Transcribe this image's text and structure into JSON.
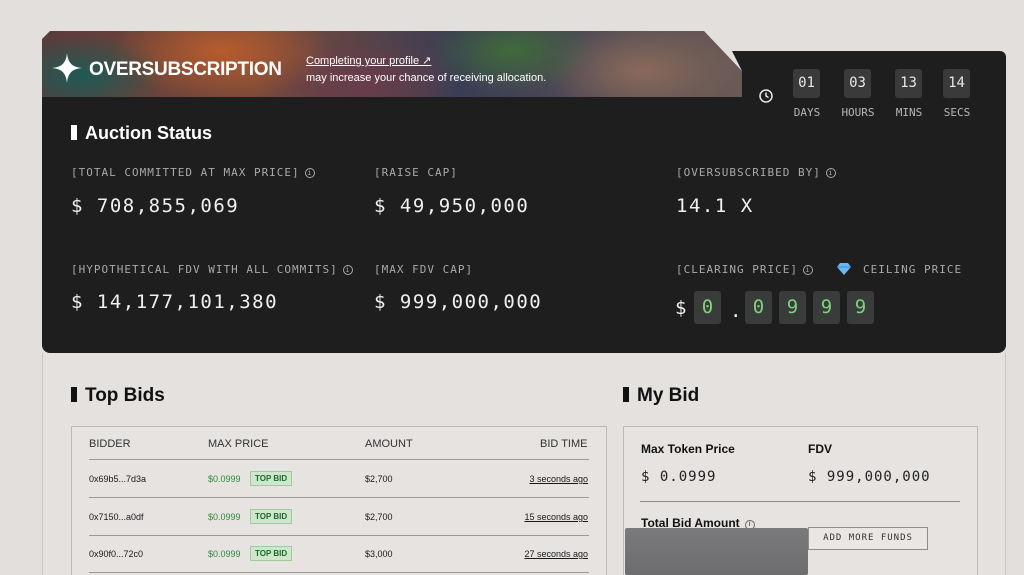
{
  "banner": {
    "title": "OVERSUBSCRIPTION",
    "note_link": "Completing your profile ↗",
    "note_text": "may increase your chance of receiving allocation."
  },
  "countdown": [
    {
      "value": "01",
      "label": "DAYS"
    },
    {
      "value": "03",
      "label": "HOURS"
    },
    {
      "value": "13",
      "label": "MINS"
    },
    {
      "value": "14",
      "label": "SECS"
    }
  ],
  "auction": {
    "heading": "Auction Status",
    "total_committed_label": "[TOTAL COMMITTED AT MAX PRICE]",
    "total_committed_value": "$ 708,855,069",
    "raise_cap_label": "[RAISE CAP]",
    "raise_cap_value": "$ 49,950,000",
    "oversubscribed_label": "[OVERSUBSCRIBED BY]",
    "oversubscribed_value": "14.1 X",
    "hypo_fdv_label": "[HYPOTHETICAL FDV WITH ALL COMMITS]",
    "hypo_fdv_value": "$ 14,177,101,380",
    "max_fdv_label": "[MAX FDV CAP]",
    "max_fdv_value": "$ 999,000,000",
    "clearing_label": "[CLEARING PRICE]",
    "ceiling_label": "CEILING PRICE",
    "clearing_currency": "$",
    "clearing_digits": [
      "0",
      "0",
      "9",
      "9",
      "9"
    ]
  },
  "top_bids": {
    "heading": "Top Bids",
    "columns": [
      "BIDDER",
      "MAX PRICE",
      "AMOUNT",
      "BID TIME"
    ],
    "rows": [
      {
        "bidder": "0x69b5...7d3a",
        "price": "$0.0999",
        "badge": "TOP BID",
        "amount": "$2,700",
        "time": "3 seconds ago"
      },
      {
        "bidder": "0x7150...a0df",
        "price": "$0.0999",
        "badge": "TOP BID",
        "amount": "$2,700",
        "time": "15 seconds ago"
      },
      {
        "bidder": "0x90f0...72c0",
        "price": "$0.0999",
        "badge": "TOP BID",
        "amount": "$3,000",
        "time": "27 seconds ago"
      }
    ]
  },
  "my_bid": {
    "heading": "My Bid",
    "max_token_price_label": "Max Token Price",
    "max_token_price_value": "$ 0.0999",
    "fdv_label": "FDV",
    "fdv_value": "$ 999,000,000",
    "total_bid_label": "Total Bid Amount",
    "add_funds_label": "ADD MORE FUNDS"
  },
  "colors": {
    "panel": "#1e1e1f",
    "digit_green": "#7ed17a",
    "price_green": "#2f8a3a"
  }
}
